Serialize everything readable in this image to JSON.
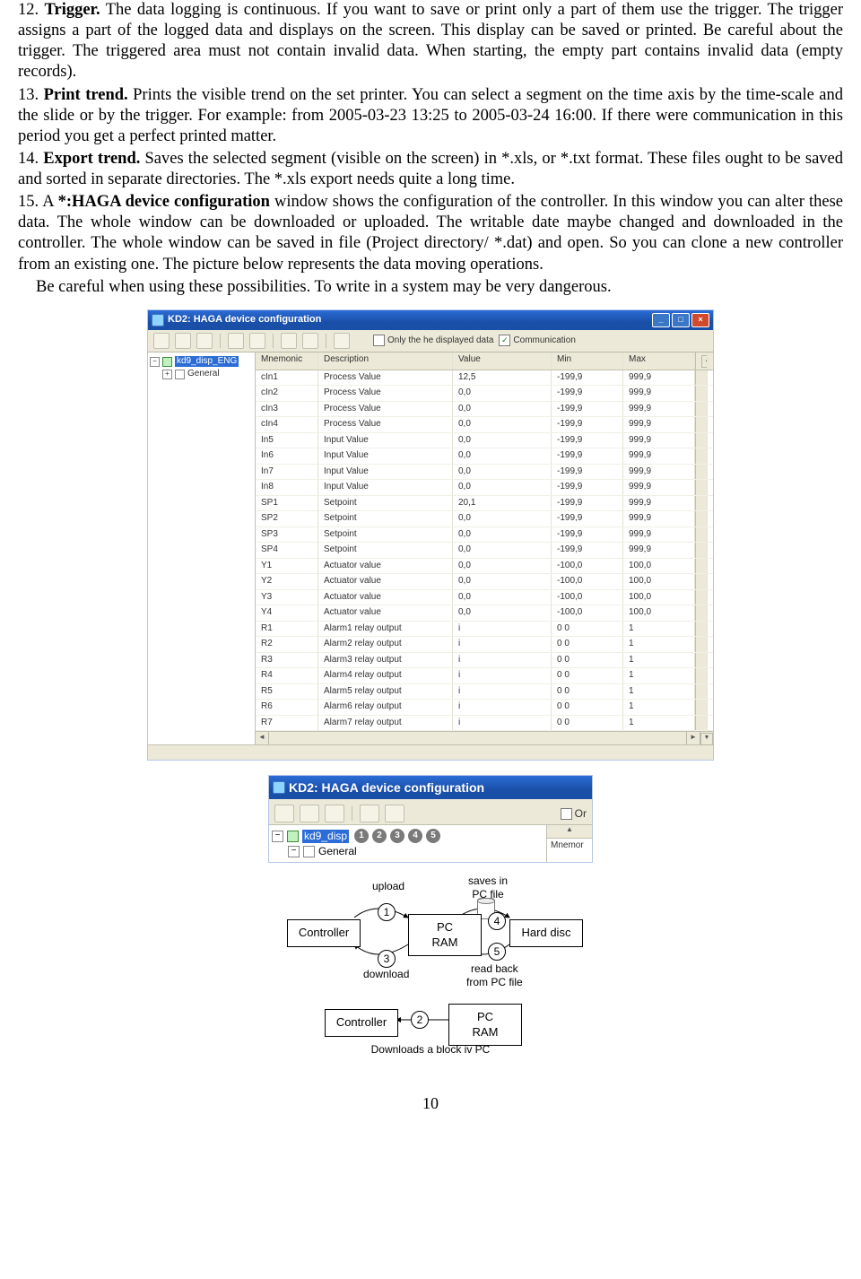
{
  "items": [
    {
      "num": "12.",
      "title": "Trigger.",
      "text": "The data logging is continuous. If you want to save or print only a part of them use the trigger. The trigger assigns a part of the logged data and displays on the screen. This display can be saved or printed. Be careful about the trigger. The triggered area must not contain invalid data. When starting, the empty part contains invalid data (empty records)."
    },
    {
      "num": "13.",
      "title": "Print trend.",
      "text": "Prints the visible trend on the set printer. You can select a segment on the time axis by the time-scale and the slide or by the trigger. For example: from 2005-03-23 13:25 to 2005-03-24 16:00. If there were communication in this period you get a perfect printed matter."
    },
    {
      "num": "14.",
      "title": "Export trend.",
      "text": "Saves the selected segment (visible on the screen) in *.xls, or *.txt format. These files ought to be saved and sorted in separate directories. The *.xls export needs quite a long time."
    },
    {
      "num": "15.",
      "title": "",
      "text": "A *:HAGA device configuration window shows the configuration of the controller. In this window you can alter these data. The whole window can be downloaded or uploaded. The writable date maybe changed and downloaded in the controller. The whole window can be saved in file (Project directory/ *.dat) and open. So you can clone a new controller from an existing one. The picture below represents the data moving operations.",
      "boldPhrase": "*:HAGA device configuration"
    }
  ],
  "warning": "Be careful when using these possibilities. To write in a system may be very dangerous.",
  "win": {
    "title": "KD2: HAGA device configuration",
    "checkbox1": "Only the he displayed data",
    "checkbox2": "Communication",
    "treeRoot": "kd9_disp_ENG",
    "treeChild": "General",
    "headers": [
      "Mnemonic",
      "Description",
      "Value",
      "Min",
      "Max"
    ],
    "rows": [
      [
        "cIn1",
        "Process Value",
        "12,5",
        "-199,9",
        "999,9"
      ],
      [
        "cIn2",
        "Process Value",
        "0,0",
        "-199,9",
        "999,9"
      ],
      [
        "cIn3",
        "Process Value",
        "0,0",
        "-199,9",
        "999,9"
      ],
      [
        "cIn4",
        "Process Value",
        "0,0",
        "-199,9",
        "999,9"
      ],
      [
        "In5",
        "Input Value",
        "0,0",
        "-199,9",
        "999,9"
      ],
      [
        "In6",
        "Input Value",
        "0,0",
        "-199,9",
        "999,9"
      ],
      [
        "In7",
        "Input Value",
        "0,0",
        "-199,9",
        "999,9"
      ],
      [
        "In8",
        "Input Value",
        "0,0",
        "-199,9",
        "999,9"
      ],
      [
        "SP1",
        "Setpoint",
        "20,1",
        "-199,9",
        "999,9"
      ],
      [
        "SP2",
        "Setpoint",
        "0,0",
        "-199,9",
        "999,9"
      ],
      [
        "SP3",
        "Setpoint",
        "0,0",
        "-199,9",
        "999,9"
      ],
      [
        "SP4",
        "Setpoint",
        "0,0",
        "-199,9",
        "999,9"
      ],
      [
        "Y1",
        "Actuator value",
        "0,0",
        "-100,0",
        "100,0"
      ],
      [
        "Y2",
        "Actuator value",
        "0,0",
        "-100,0",
        "100,0"
      ],
      [
        "Y3",
        "Actuator value",
        "0,0",
        "-100,0",
        "100,0"
      ],
      [
        "Y4",
        "Actuator value",
        "0,0",
        "-100,0",
        "100,0"
      ],
      [
        "R1",
        "Alarm1 relay output",
        "i",
        "0 0",
        "1"
      ],
      [
        "R2",
        "Alarm2 relay output",
        "i",
        "0 0",
        "1"
      ],
      [
        "R3",
        "Alarm3 relay output",
        "i",
        "0 0",
        "1"
      ],
      [
        "R4",
        "Alarm4 relay output",
        "i",
        "0 0",
        "1"
      ],
      [
        "R5",
        "Alarm5 relay output",
        "i",
        "0 0",
        "1"
      ],
      [
        "R6",
        "Alarm6 relay output",
        "i",
        "0 0",
        "1"
      ],
      [
        "R7",
        "Alarm7 relay output",
        "i",
        "0 0",
        "1"
      ]
    ],
    "status": "Downloads a block iv PC"
  },
  "win2": {
    "title": "KD2: HAGA device configuration",
    "node1": "kd9_disp",
    "node2": "General",
    "badges": [
      "1",
      "2",
      "3",
      "4",
      "5"
    ],
    "mnem": "Mnemor"
  },
  "diag1": {
    "controller": "Controller",
    "ram": "PC\nRAM",
    "hard": "Hard disc",
    "upload": "upload",
    "download": "download",
    "saves": "saves in\nPC file",
    "readback": "read back\nfrom PC file",
    "n1": "1",
    "n3": "3",
    "n4": "4",
    "n5": "5"
  },
  "diag2": {
    "controller": "Controller",
    "ram": "PC\nRAM",
    "n2": "2",
    "caption": "Downloads a block iv PC"
  },
  "pagenum": "10"
}
